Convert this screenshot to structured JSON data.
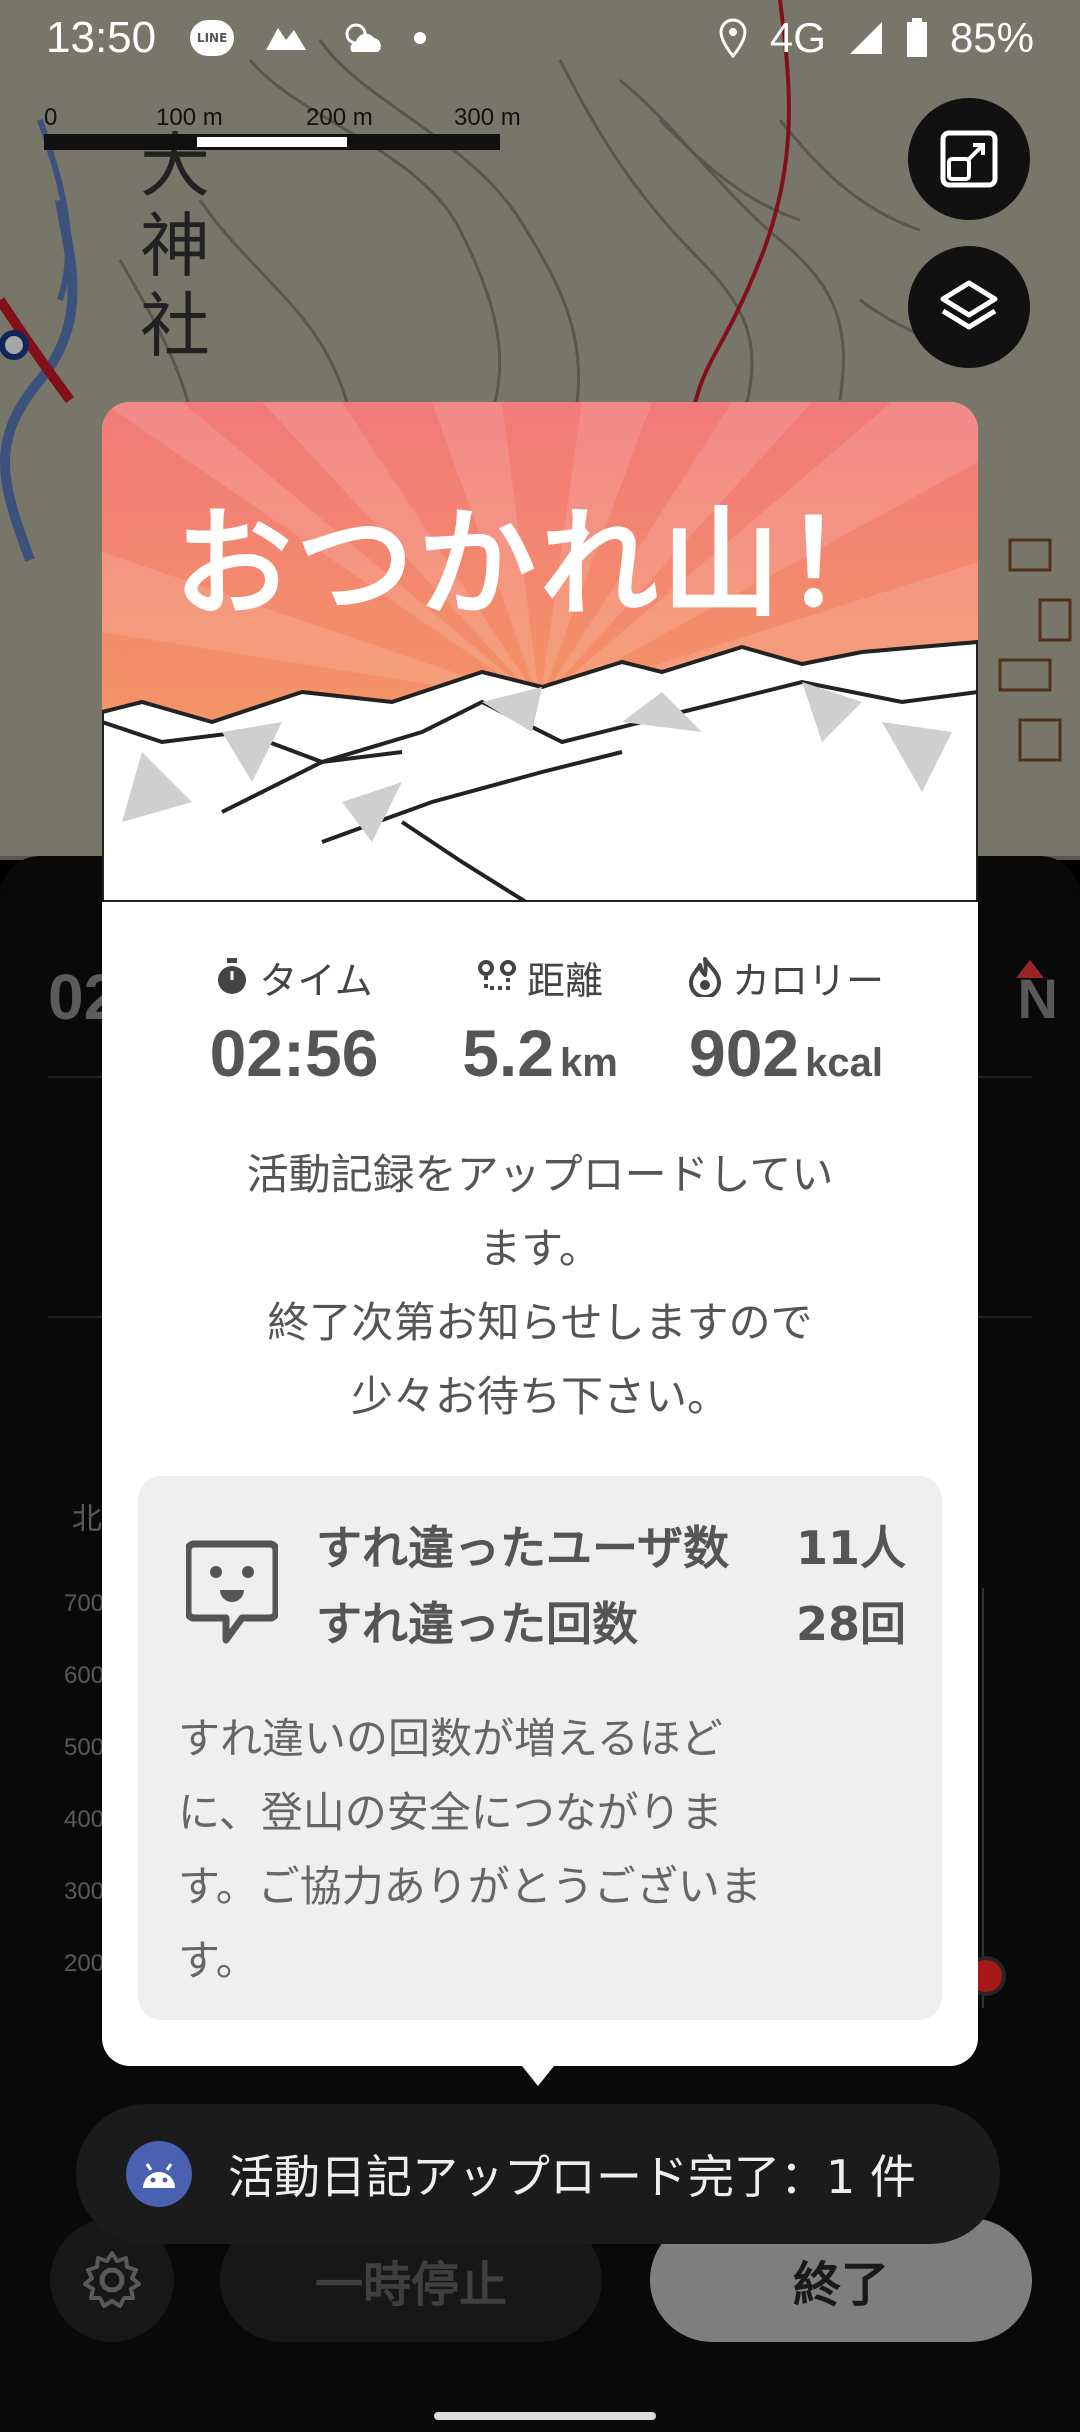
{
  "status_bar": {
    "time": "13:50",
    "line_label": "LINE",
    "network": "4G",
    "battery": "85%",
    "icons": [
      "line-icon",
      "yamap-icon",
      "weather-icon",
      "notification-dot",
      "location-icon",
      "signal-icon",
      "battery-icon"
    ]
  },
  "map": {
    "scale_labels": [
      "0",
      "100 m",
      "200 m",
      "300 m"
    ],
    "kanji": [
      "大",
      "神",
      "社"
    ],
    "buttons": [
      "map-expand-icon",
      "layers-icon"
    ]
  },
  "background_panel": {
    "time_peek": "02",
    "compass_peek": "N",
    "direction_label": "北",
    "elevation_ticks": [
      "700",
      "600",
      "500",
      "400",
      "300",
      "200"
    ]
  },
  "modal": {
    "title": "おつかれ山！",
    "stats": {
      "time": {
        "label": "タイム",
        "value": "02:56",
        "unit": ""
      },
      "distance": {
        "label": "距離",
        "value": "5.2",
        "unit": "km"
      },
      "calories": {
        "label": "カロリー",
        "value": "902",
        "unit": "kcal"
      }
    },
    "upload_message_lines": [
      "活動記録をアップロードしてい",
      "ます。",
      "終了次第お知らせしますので",
      "少々お待ち下さい。"
    ],
    "passing": {
      "users_label": "すれ違ったユーザ数",
      "users_value": "11人",
      "count_label": "すれ違った回数",
      "count_value": "28回",
      "note_lines": [
        "すれ違いの回数が増えるほど",
        "に、登山の安全につながりま",
        "す。ご協力ありがとうございま",
        "す。"
      ]
    },
    "colors": {
      "hero_top": "#f27a7a",
      "hero_bottom": "#f5a35a",
      "accent_gray": "#555555"
    }
  },
  "toast": {
    "text": "活動日記アップロード完了：1 件"
  },
  "actions": {
    "pause_label": "一時停止",
    "end_label": "終了"
  }
}
